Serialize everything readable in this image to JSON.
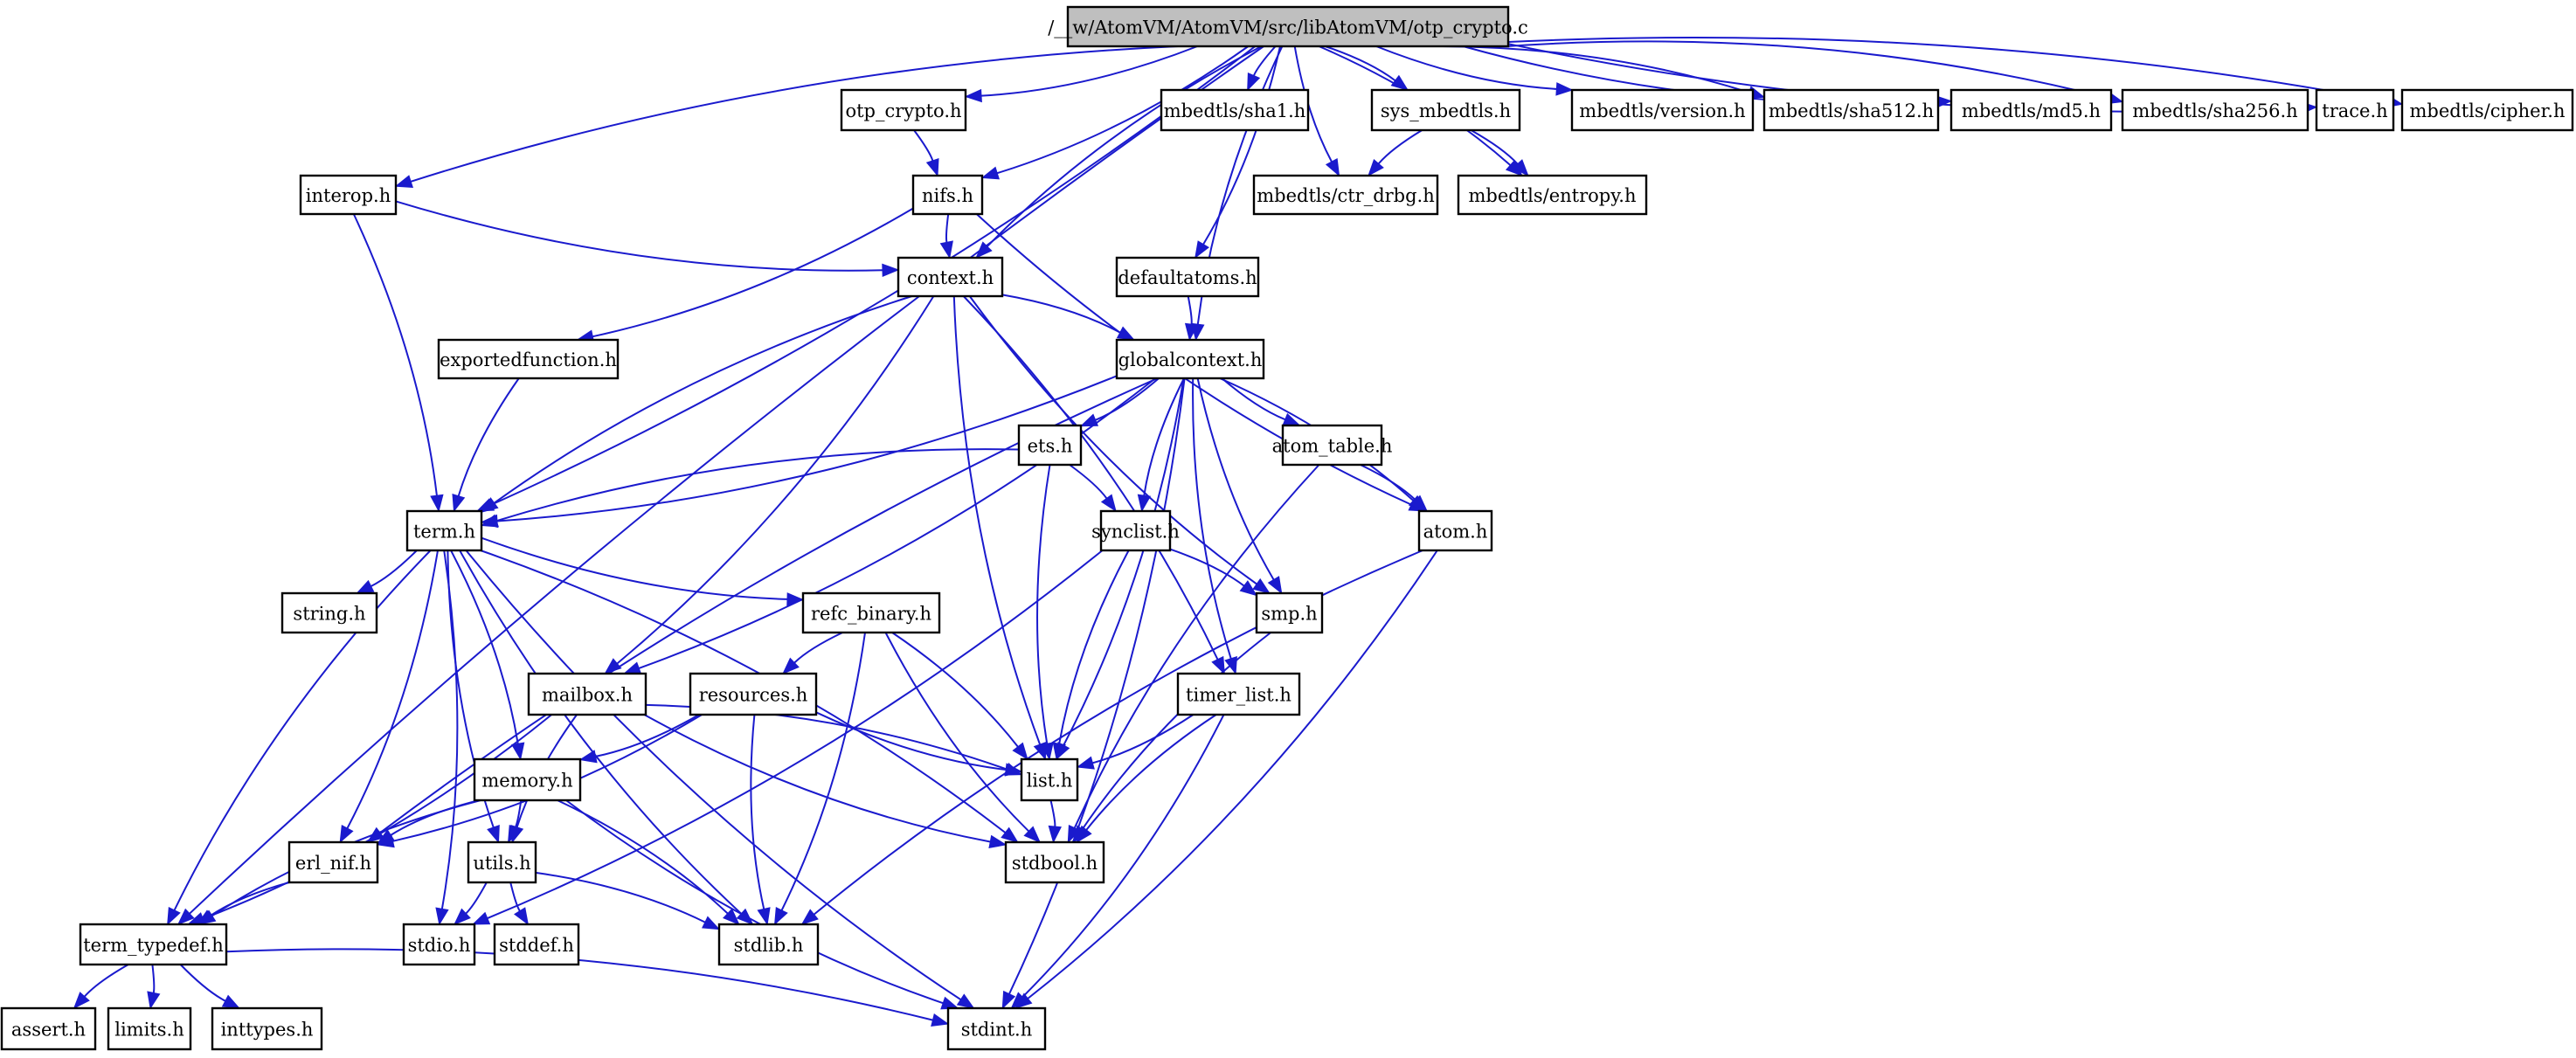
{
  "graph": {
    "title": "/__w/AtomVM/AtomVM/src/libAtomVM/otp_crypto.c",
    "root": "root",
    "colors": {
      "edge": "#1a1acd",
      "root_fill": "#bfbfbf",
      "node_fill": "#ffffff",
      "node_border": "#000000"
    },
    "nodes": [
      {
        "id": "root",
        "label": "/__w/AtomVM/AtomVM/src/libAtomVM/otp_crypto.c"
      },
      {
        "id": "otp_crypto_h",
        "label": "otp_crypto.h"
      },
      {
        "id": "sha1",
        "label": "mbedtls/sha1.h"
      },
      {
        "id": "sys_mbedtls",
        "label": "sys_mbedtls.h"
      },
      {
        "id": "version",
        "label": "mbedtls/version.h"
      },
      {
        "id": "sha512",
        "label": "mbedtls/sha512.h"
      },
      {
        "id": "md5",
        "label": "mbedtls/md5.h"
      },
      {
        "id": "sha256",
        "label": "mbedtls/sha256.h"
      },
      {
        "id": "trace",
        "label": "trace.h"
      },
      {
        "id": "cipher",
        "label": "mbedtls/cipher.h"
      },
      {
        "id": "interop",
        "label": "interop.h"
      },
      {
        "id": "nifs",
        "label": "nifs.h"
      },
      {
        "id": "ctr_drbg",
        "label": "mbedtls/ctr_drbg.h"
      },
      {
        "id": "entropy",
        "label": "mbedtls/entropy.h"
      },
      {
        "id": "context",
        "label": "context.h"
      },
      {
        "id": "defaultatoms",
        "label": "defaultatoms.h"
      },
      {
        "id": "exportedfunction",
        "label": "exportedfunction.h"
      },
      {
        "id": "globalcontext",
        "label": "globalcontext.h"
      },
      {
        "id": "ets",
        "label": "ets.h"
      },
      {
        "id": "atom_table",
        "label": "atom_table.h"
      },
      {
        "id": "term",
        "label": "term.h"
      },
      {
        "id": "synclist",
        "label": "synclist.h"
      },
      {
        "id": "atom",
        "label": "atom.h"
      },
      {
        "id": "string",
        "label": "string.h"
      },
      {
        "id": "refc_binary",
        "label": "refc_binary.h"
      },
      {
        "id": "smp",
        "label": "smp.h"
      },
      {
        "id": "mailbox",
        "label": "mailbox.h"
      },
      {
        "id": "resources",
        "label": "resources.h"
      },
      {
        "id": "timer_list",
        "label": "timer_list.h"
      },
      {
        "id": "memory",
        "label": "memory.h"
      },
      {
        "id": "list",
        "label": "list.h"
      },
      {
        "id": "erl_nif",
        "label": "erl_nif.h"
      },
      {
        "id": "utils",
        "label": "utils.h"
      },
      {
        "id": "stdbool",
        "label": "stdbool.h"
      },
      {
        "id": "term_typedef",
        "label": "term_typedef.h"
      },
      {
        "id": "stdio",
        "label": "stdio.h"
      },
      {
        "id": "stddef",
        "label": "stddef.h"
      },
      {
        "id": "stdlib",
        "label": "stdlib.h"
      },
      {
        "id": "assert",
        "label": "assert.h"
      },
      {
        "id": "limits",
        "label": "limits.h"
      },
      {
        "id": "inttypes",
        "label": "inttypes.h"
      },
      {
        "id": "stdint",
        "label": "stdint.h"
      }
    ],
    "edges": [
      [
        "root",
        "otp_crypto_h"
      ],
      [
        "root",
        "sha1"
      ],
      [
        "root",
        "sys_mbedtls"
      ],
      [
        "root",
        "version"
      ],
      [
        "root",
        "sha512"
      ],
      [
        "root",
        "md5"
      ],
      [
        "root",
        "sha256"
      ],
      [
        "root",
        "trace"
      ],
      [
        "root",
        "cipher"
      ],
      [
        "root",
        "interop"
      ],
      [
        "root",
        "nifs"
      ],
      [
        "root",
        "ctr_drbg"
      ],
      [
        "root",
        "entropy"
      ],
      [
        "root",
        "context"
      ],
      [
        "root",
        "defaultatoms"
      ],
      [
        "root",
        "globalcontext"
      ],
      [
        "root",
        "term"
      ],
      [
        "root",
        "term_typedef"
      ],
      [
        "otp_crypto_h",
        "nifs"
      ],
      [
        "sys_mbedtls",
        "ctr_drbg"
      ],
      [
        "sys_mbedtls",
        "entropy"
      ],
      [
        "interop",
        "context"
      ],
      [
        "interop",
        "term"
      ],
      [
        "nifs",
        "context"
      ],
      [
        "nifs",
        "exportedfunction"
      ],
      [
        "nifs",
        "atom"
      ],
      [
        "context",
        "globalcontext"
      ],
      [
        "context",
        "term"
      ],
      [
        "context",
        "mailbox"
      ],
      [
        "context",
        "list"
      ],
      [
        "context",
        "timer_list"
      ],
      [
        "context",
        "smp"
      ],
      [
        "defaultatoms",
        "globalcontext"
      ],
      [
        "exportedfunction",
        "term"
      ],
      [
        "globalcontext",
        "ets"
      ],
      [
        "globalcontext",
        "atom_table"
      ],
      [
        "globalcontext",
        "term"
      ],
      [
        "globalcontext",
        "synclist"
      ],
      [
        "globalcontext",
        "atom"
      ],
      [
        "globalcontext",
        "smp"
      ],
      [
        "globalcontext",
        "mailbox"
      ],
      [
        "globalcontext",
        "timer_list"
      ],
      [
        "globalcontext",
        "list"
      ],
      [
        "globalcontext",
        "erl_nif"
      ],
      [
        "globalcontext",
        "stdint"
      ],
      [
        "ets",
        "term"
      ],
      [
        "ets",
        "synclist"
      ],
      [
        "ets",
        "list"
      ],
      [
        "atom_table",
        "atom"
      ],
      [
        "atom_table",
        "stdbool"
      ],
      [
        "term",
        "string"
      ],
      [
        "term",
        "refc_binary"
      ],
      [
        "term",
        "memory"
      ],
      [
        "term",
        "utils"
      ],
      [
        "term",
        "erl_nif"
      ],
      [
        "term",
        "term_typedef"
      ],
      [
        "term",
        "stdio"
      ],
      [
        "term",
        "stdlib"
      ],
      [
        "term",
        "stdbool"
      ],
      [
        "term",
        "stdint"
      ],
      [
        "synclist",
        "smp"
      ],
      [
        "synclist",
        "list"
      ],
      [
        "synclist",
        "stdio"
      ],
      [
        "atom",
        "stdlib"
      ],
      [
        "atom",
        "stdint"
      ],
      [
        "refc_binary",
        "resources"
      ],
      [
        "refc_binary",
        "list"
      ],
      [
        "refc_binary",
        "stdbool"
      ],
      [
        "refc_binary",
        "stdlib"
      ],
      [
        "smp",
        "stdbool"
      ],
      [
        "mailbox",
        "list"
      ],
      [
        "mailbox",
        "utils"
      ],
      [
        "mailbox",
        "term_typedef"
      ],
      [
        "mailbox",
        "stdbool"
      ],
      [
        "resources",
        "memory"
      ],
      [
        "resources",
        "list"
      ],
      [
        "resources",
        "erl_nif"
      ],
      [
        "resources",
        "stdlib"
      ],
      [
        "timer_list",
        "list"
      ],
      [
        "timer_list",
        "stdbool"
      ],
      [
        "timer_list",
        "stdint"
      ],
      [
        "memory",
        "erl_nif"
      ],
      [
        "memory",
        "utils"
      ],
      [
        "memory",
        "term_typedef"
      ],
      [
        "memory",
        "stdlib"
      ],
      [
        "memory",
        "stdint"
      ],
      [
        "list",
        "stdbool"
      ],
      [
        "erl_nif",
        "term_typedef"
      ],
      [
        "utils",
        "stdio"
      ],
      [
        "utils",
        "stddef"
      ],
      [
        "utils",
        "stdlib"
      ],
      [
        "term_typedef",
        "assert"
      ],
      [
        "term_typedef",
        "limits"
      ],
      [
        "term_typedef",
        "inttypes"
      ],
      [
        "term_typedef",
        "stdint"
      ]
    ]
  }
}
